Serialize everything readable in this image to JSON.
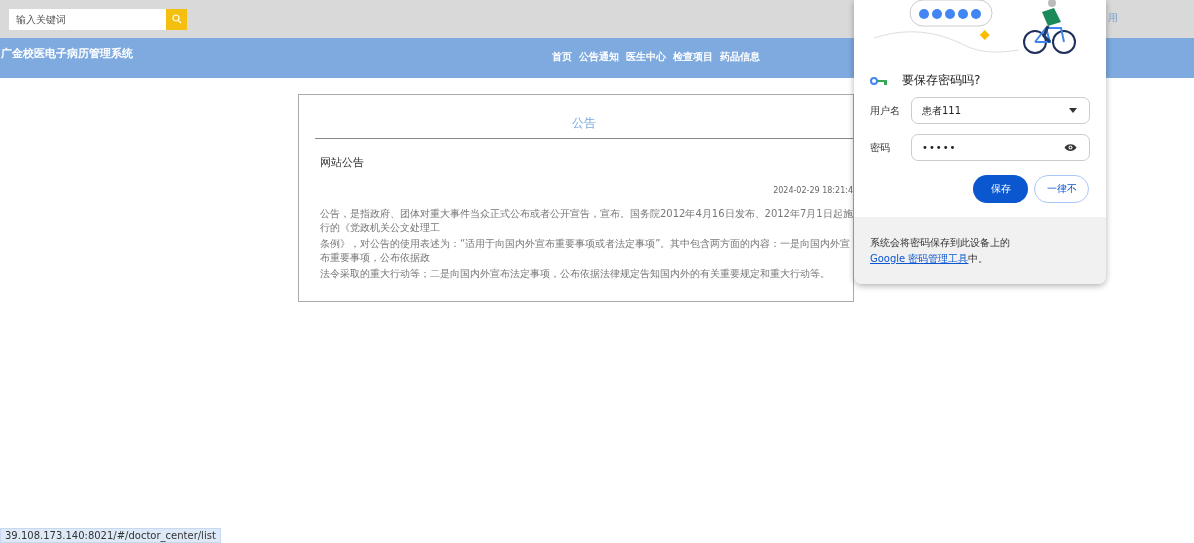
{
  "search": {
    "placeholder": "输入关键词"
  },
  "top_right": {
    "text": "用"
  },
  "header": {
    "title": "广金校医电子病历管理系统",
    "nav": [
      "首页",
      "公告通知",
      "医生中心",
      "检查项目",
      "药品信息"
    ]
  },
  "notice": {
    "heading": "公告",
    "title": "网站公告",
    "date": "2024-02-29 18:21:4",
    "lines": [
      "公告，是指政府、团体对重大事件当众正式公布或者公开宣告，宣布。国务院2012年4月16日发布、2012年7月1日起施行的《党政机关公文处理工",
      "条例》，对公告的使用表述为：“适用于向国内外宣布重要事项或者法定事项”。其中包含两方面的内容：一是向国内外宣布重要事项，公布依据政",
      "法令采取的重大行动等；二是向国内外宣布法定事项，公布依据法律规定告知国内外的有关重要规定和重大行动等。"
    ]
  },
  "password_popup": {
    "title": "要保存密码吗?",
    "username_label": "用户名",
    "username": "患者111",
    "password_label": "密码",
    "password": "•••••",
    "save": "保存",
    "never": "一律不",
    "footer_text": "系统会将密码保存到此设备上的 ",
    "footer_link": "Google 密码管理工具",
    "footer_end": "中。"
  },
  "status_bar": {
    "url": "39.108.173.140:8021/#/doctor_center/list"
  }
}
